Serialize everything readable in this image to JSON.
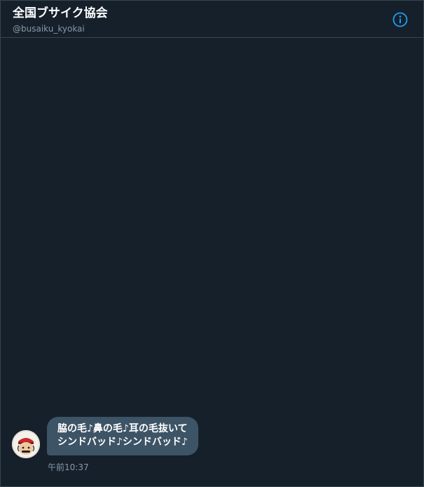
{
  "header": {
    "title": "全国ブサイク協会",
    "handle": "@busaiku_kyokai",
    "info_icon": "info-icon"
  },
  "message": {
    "text": "脇の毛♪鼻の毛♪耳の毛抜いて\nシンドバッド♪シンドバッド♪",
    "time": "午前10:37",
    "avatar_icon": "avatar-illustration"
  },
  "colors": {
    "background": "#15202b",
    "border": "#38444d",
    "bubble": "#3d5466",
    "accent": "#1da1f2",
    "secondary_text": "#8899a6"
  }
}
